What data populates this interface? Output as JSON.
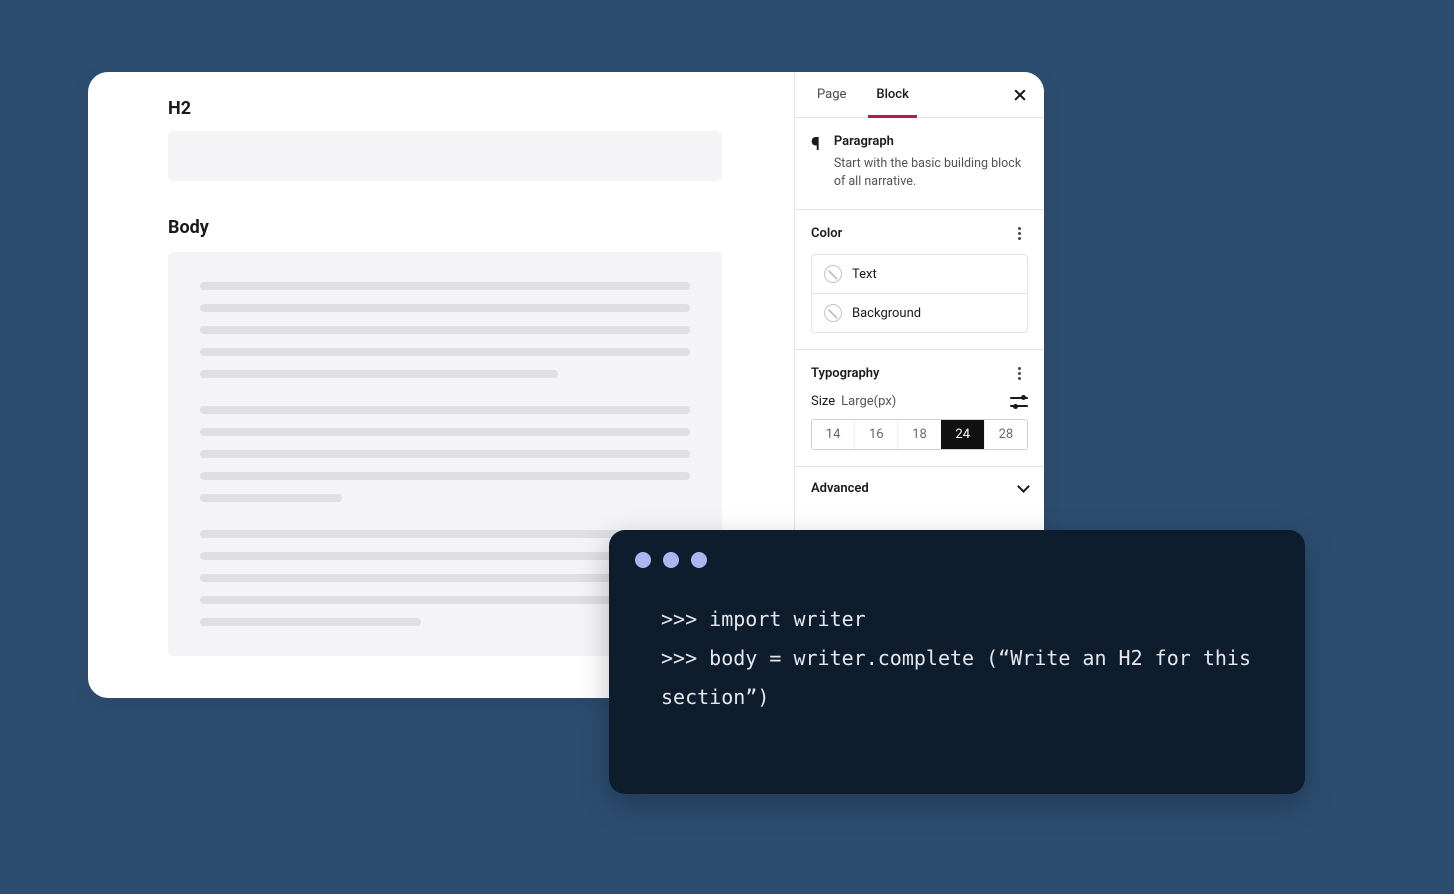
{
  "editor": {
    "labels": {
      "h2": "H2",
      "body": "Body"
    }
  },
  "sidebar": {
    "tabs": {
      "page": "Page",
      "block": "Block"
    },
    "block": {
      "title": "Paragraph",
      "description": "Start with the basic building block of all narrative."
    },
    "color": {
      "heading": "Color",
      "text_label": "Text",
      "background_label": "Background"
    },
    "typography": {
      "heading": "Typography",
      "size_label": "Size",
      "size_unit": "Large(px)",
      "sizes": [
        "14",
        "16",
        "18",
        "24",
        "28"
      ],
      "active_size_index": 3
    },
    "advanced_label": "Advanced"
  },
  "terminal": {
    "lines": [
      ">>> import writer",
      ">>> body = writer.complete (“Write an H2 for this section”)"
    ]
  }
}
